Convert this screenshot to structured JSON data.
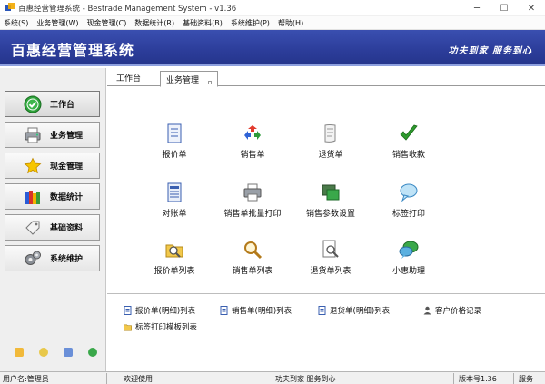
{
  "window": {
    "title": "百惠经营管理系统 - Bestrade Management System - v1.36",
    "minimize_glyph": "─",
    "maximize_glyph": "☐",
    "close_glyph": "✕"
  },
  "menu": [
    "系统(S)",
    "业务管理(W)",
    "现金管理(C)",
    "数据统计(R)",
    "基础资料(B)",
    "系统维护(P)",
    "帮助(H)"
  ],
  "banner": {
    "title": "百惠经营管理系统",
    "slogan": "功夫到家 服务到心",
    "color": "#2c3d9a"
  },
  "sidebar": {
    "items": [
      {
        "label": "工作台",
        "icon": "check-circle-icon",
        "active": true
      },
      {
        "label": "业务管理",
        "icon": "printer-icon"
      },
      {
        "label": "现金管理",
        "icon": "star-icon"
      },
      {
        "label": "数据统计",
        "icon": "books-icon"
      },
      {
        "label": "基础资料",
        "icon": "tag-icon"
      },
      {
        "label": "系统维护",
        "icon": "gears-icon"
      }
    ],
    "mini_icons": [
      "folder-icon",
      "help-icon",
      "search-doc-icon",
      "globe-icon"
    ]
  },
  "tabs": {
    "plain": "工作台",
    "active": "业务管理"
  },
  "functions": [
    {
      "label": "报价单",
      "icon": "document-icon"
    },
    {
      "label": "销售单",
      "icon": "recycle-icon"
    },
    {
      "label": "退货单",
      "icon": "scroll-icon"
    },
    {
      "label": "销售收款",
      "icon": "checkmark-icon"
    },
    {
      "label": "对账单",
      "icon": "ledger-icon"
    },
    {
      "label": "销售单批量打印",
      "icon": "printer-icon"
    },
    {
      "label": "销售参数设置",
      "icon": "monitor-icon"
    },
    {
      "label": "标签打印",
      "icon": "speech-bubble-icon"
    },
    {
      "label": "报价单列表",
      "icon": "search-folder-icon"
    },
    {
      "label": "销售单列表",
      "icon": "magnifier-icon"
    },
    {
      "label": "退货单列表",
      "icon": "search-doc-icon"
    },
    {
      "label": "小惠助理",
      "icon": "chat-icon"
    }
  ],
  "links": [
    {
      "label": "报价单(明细)列表",
      "icon": "doc-small-icon"
    },
    {
      "label": "销售单(明细)列表",
      "icon": "doc-small-icon"
    },
    {
      "label": "退货单(明细)列表",
      "icon": "doc-small-icon"
    },
    {
      "label": "客户价格记录",
      "icon": "user-small-icon"
    },
    {
      "label": "标签打印模板列表",
      "icon": "folder-small-icon"
    }
  ],
  "status": {
    "user": "用户名:管理员",
    "welcome": "欢迎使用",
    "slogan": "功夫到家 服务到心",
    "version": "版本号1.36",
    "service": "服务"
  }
}
